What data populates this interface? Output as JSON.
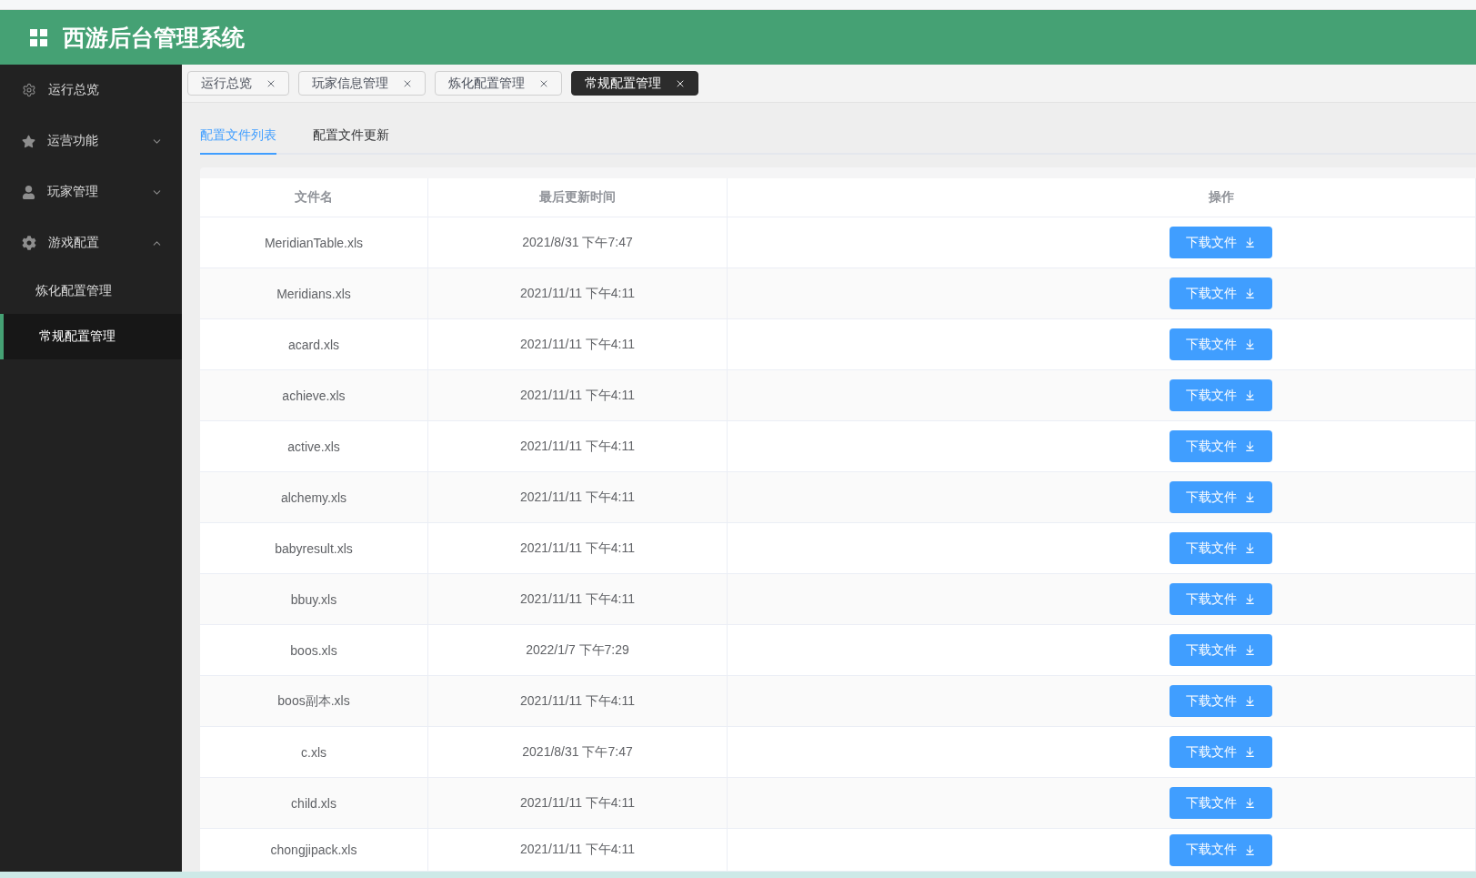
{
  "header": {
    "title": "西游后台管理系统"
  },
  "sidebar": {
    "items": [
      {
        "label": "运行总览",
        "selected": false
      },
      {
        "label": "运营功能",
        "selected": false,
        "expanded": false
      },
      {
        "label": "玩家管理",
        "selected": false,
        "expanded": false
      },
      {
        "label": "游戏配置",
        "selected": false,
        "expanded": true,
        "children": [
          {
            "label": "炼化配置管理",
            "selected": false
          },
          {
            "label": "常规配置管理",
            "selected": true
          }
        ]
      }
    ]
  },
  "tags": [
    {
      "label": "运行总览",
      "selected": false
    },
    {
      "label": "玩家信息管理",
      "selected": false
    },
    {
      "label": "炼化配置管理",
      "selected": false
    },
    {
      "label": "常规配置管理",
      "selected": true
    }
  ],
  "subtabs": [
    {
      "label": "配置文件列表",
      "selected": true
    },
    {
      "label": "配置文件更新",
      "selected": false
    }
  ],
  "table": {
    "columns": [
      "文件名",
      "最后更新时间",
      "操作"
    ],
    "rows": [
      {
        "file": "MeridianTable.xls",
        "updated": "2021/8/31 下午7:47",
        "action": "下载文件"
      },
      {
        "file": "Meridians.xls",
        "updated": "2021/11/11 下午4:11",
        "action": "下载文件"
      },
      {
        "file": "acard.xls",
        "updated": "2021/11/11 下午4:11",
        "action": "下载文件"
      },
      {
        "file": "achieve.xls",
        "updated": "2021/11/11 下午4:11",
        "action": "下载文件"
      },
      {
        "file": "active.xls",
        "updated": "2021/11/11 下午4:11",
        "action": "下载文件"
      },
      {
        "file": "alchemy.xls",
        "updated": "2021/11/11 下午4:11",
        "action": "下载文件"
      },
      {
        "file": "babyresult.xls",
        "updated": "2021/11/11 下午4:11",
        "action": "下载文件"
      },
      {
        "file": "bbuy.xls",
        "updated": "2021/11/11 下午4:11",
        "action": "下载文件"
      },
      {
        "file": "boos.xls",
        "updated": "2022/1/7 下午7:29",
        "action": "下载文件"
      },
      {
        "file": "boos副本.xls",
        "updated": "2021/11/11 下午4:11",
        "action": "下载文件"
      },
      {
        "file": "c.xls",
        "updated": "2021/8/31 下午7:47",
        "action": "下载文件"
      },
      {
        "file": "child.xls",
        "updated": "2021/11/11 下午4:11",
        "action": "下载文件"
      },
      {
        "file": "chongjipack.xls",
        "updated": "2021/11/11 下午4:11",
        "action": "下载文件"
      }
    ]
  }
}
